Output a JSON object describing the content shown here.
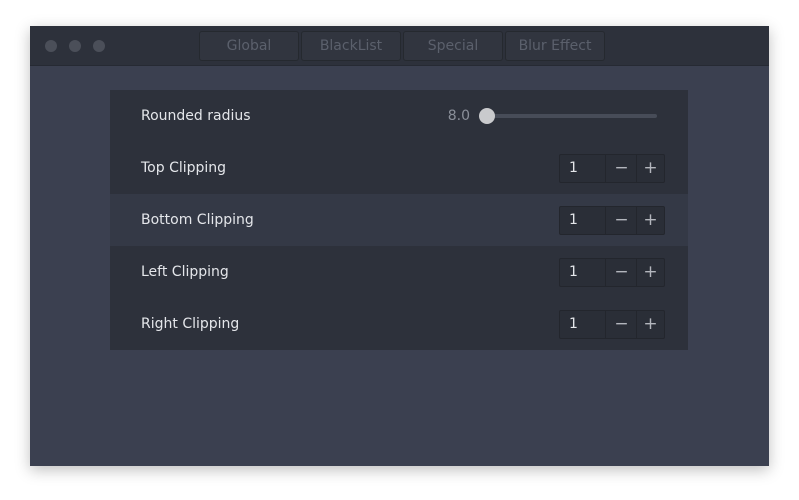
{
  "window": {
    "tabs": [
      {
        "label": "Global"
      },
      {
        "label": "BlackList"
      },
      {
        "label": "Special"
      },
      {
        "label": "Blur Effect"
      }
    ]
  },
  "settings": {
    "rounded_radius": {
      "label": "Rounded radius",
      "value": "8.0",
      "slider_fraction": 0.0
    },
    "top_clipping": {
      "label": "Top Clipping",
      "value": "1"
    },
    "bottom_clipping": {
      "label": "Bottom Clipping",
      "value": "1"
    },
    "left_clipping": {
      "label": "Left Clipping",
      "value": "1"
    },
    "right_clipping": {
      "label": "Right Clipping",
      "value": "1"
    }
  },
  "stepper_symbols": {
    "minus": "−",
    "plus": "+"
  },
  "colors": {
    "window_bg": "#3b4050",
    "titlebar_bg": "#2d313b",
    "panel_bg": "#2d313b",
    "row_highlight": "#343946",
    "text": "#e4e6ea",
    "tab_text": "#5b606c"
  }
}
